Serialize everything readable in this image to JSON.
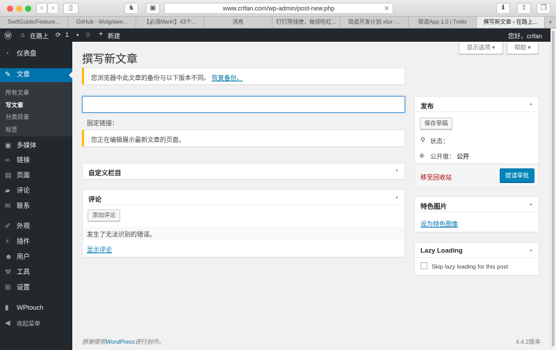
{
  "browser": {
    "url": "www.crifan.com/wp-admin/post-new.php",
    "tabs": [
      "SwiftGuide/Feature...",
      "GitHub - Wolg/awe...",
      "【必须Mark!】43个...",
      "消息",
      "钉钉用钱德，做卻吃红...",
      "简道开发计划.xlsx -...",
      "简道App 1.0 | Trello",
      "撰写新文章 ‹ 在路上..."
    ],
    "new_tab": "+"
  },
  "adminbar": {
    "site": "在路上",
    "updates": "1",
    "comments": "0",
    "new": "新建",
    "greeting": "您好，crifan"
  },
  "sidebar": {
    "items": [
      {
        "label": "仪表盘",
        "icon": "dashboard-icon"
      },
      {
        "label": "文章",
        "icon": "pin-icon"
      },
      {
        "label": "多媒体",
        "icon": "media-icon"
      },
      {
        "label": "链接",
        "icon": "link-icon"
      },
      {
        "label": "页面",
        "icon": "page-icon"
      },
      {
        "label": "评论",
        "icon": "comment-icon"
      },
      {
        "label": "联系",
        "icon": "mail-icon"
      },
      {
        "label": "外观",
        "icon": "brush-icon"
      },
      {
        "label": "插件",
        "icon": "plugin-icon"
      },
      {
        "label": "用户",
        "icon": "user-icon"
      },
      {
        "label": "工具",
        "icon": "wrench-icon"
      },
      {
        "label": "设置",
        "icon": "settings-icon"
      },
      {
        "label": "WPtouch",
        "icon": "phone-icon"
      },
      {
        "label": "收起菜单",
        "icon": "collapse-icon"
      }
    ],
    "submenu": [
      "所有文章",
      "写文章",
      "分类目录",
      "标签"
    ]
  },
  "main": {
    "title": "撰写新文章",
    "screen_options": "显示选项",
    "help": "帮助",
    "backup_notice": "您浏览器中此文章的备份与以下版本不同。",
    "restore_link": "恢复备份。",
    "title_placeholder": "",
    "permalink_label": "固定链接：",
    "editing_notice": "您正在编辑展示最新文章的页面。",
    "custom_fields": "自定义栏目",
    "comments": {
      "title": "评论",
      "add_button": "添加评论",
      "error": "发生了无法识别的错误。",
      "show_link": "显示评论"
    }
  },
  "publish": {
    "title": "发布",
    "save_draft": "保存草稿",
    "status_label": "状态：",
    "visibility_label": "公开度：",
    "visibility_value": "公开",
    "trash": "移至回收站",
    "submit": "提请审批"
  },
  "featured": {
    "title": "特色图片",
    "set_link": "设为特色图像"
  },
  "lazy": {
    "title": "Lazy Loading",
    "checkbox_label": "Skip lazy loading for this post",
    "checked": false
  },
  "footer": {
    "thanks_prefix": "感谢使用",
    "wordpress": "WordPress",
    "thanks_suffix": "进行创作。",
    "version": "4.4.2版本"
  }
}
